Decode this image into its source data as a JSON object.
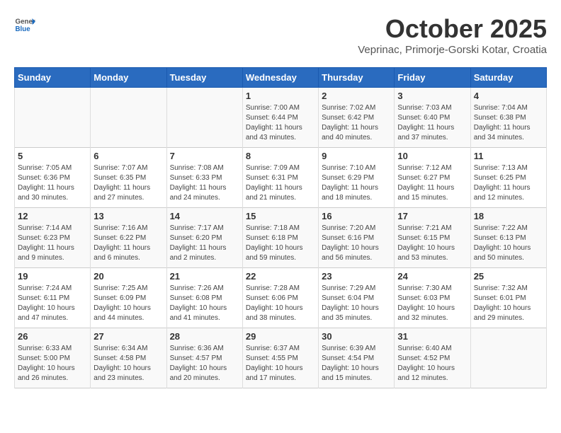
{
  "header": {
    "logo_general": "General",
    "logo_blue": "Blue",
    "month_title": "October 2025",
    "location": "Veprinac, Primorje-Gorski Kotar, Croatia"
  },
  "days_of_week": [
    "Sunday",
    "Monday",
    "Tuesday",
    "Wednesday",
    "Thursday",
    "Friday",
    "Saturday"
  ],
  "weeks": [
    [
      {
        "day": "",
        "content": ""
      },
      {
        "day": "",
        "content": ""
      },
      {
        "day": "",
        "content": ""
      },
      {
        "day": "1",
        "content": "Sunrise: 7:00 AM\nSunset: 6:44 PM\nDaylight: 11 hours\nand 43 minutes."
      },
      {
        "day": "2",
        "content": "Sunrise: 7:02 AM\nSunset: 6:42 PM\nDaylight: 11 hours\nand 40 minutes."
      },
      {
        "day": "3",
        "content": "Sunrise: 7:03 AM\nSunset: 6:40 PM\nDaylight: 11 hours\nand 37 minutes."
      },
      {
        "day": "4",
        "content": "Sunrise: 7:04 AM\nSunset: 6:38 PM\nDaylight: 11 hours\nand 34 minutes."
      }
    ],
    [
      {
        "day": "5",
        "content": "Sunrise: 7:05 AM\nSunset: 6:36 PM\nDaylight: 11 hours\nand 30 minutes."
      },
      {
        "day": "6",
        "content": "Sunrise: 7:07 AM\nSunset: 6:35 PM\nDaylight: 11 hours\nand 27 minutes."
      },
      {
        "day": "7",
        "content": "Sunrise: 7:08 AM\nSunset: 6:33 PM\nDaylight: 11 hours\nand 24 minutes."
      },
      {
        "day": "8",
        "content": "Sunrise: 7:09 AM\nSunset: 6:31 PM\nDaylight: 11 hours\nand 21 minutes."
      },
      {
        "day": "9",
        "content": "Sunrise: 7:10 AM\nSunset: 6:29 PM\nDaylight: 11 hours\nand 18 minutes."
      },
      {
        "day": "10",
        "content": "Sunrise: 7:12 AM\nSunset: 6:27 PM\nDaylight: 11 hours\nand 15 minutes."
      },
      {
        "day": "11",
        "content": "Sunrise: 7:13 AM\nSunset: 6:25 PM\nDaylight: 11 hours\nand 12 minutes."
      }
    ],
    [
      {
        "day": "12",
        "content": "Sunrise: 7:14 AM\nSunset: 6:23 PM\nDaylight: 11 hours\nand 9 minutes."
      },
      {
        "day": "13",
        "content": "Sunrise: 7:16 AM\nSunset: 6:22 PM\nDaylight: 11 hours\nand 6 minutes."
      },
      {
        "day": "14",
        "content": "Sunrise: 7:17 AM\nSunset: 6:20 PM\nDaylight: 11 hours\nand 2 minutes."
      },
      {
        "day": "15",
        "content": "Sunrise: 7:18 AM\nSunset: 6:18 PM\nDaylight: 10 hours\nand 59 minutes."
      },
      {
        "day": "16",
        "content": "Sunrise: 7:20 AM\nSunset: 6:16 PM\nDaylight: 10 hours\nand 56 minutes."
      },
      {
        "day": "17",
        "content": "Sunrise: 7:21 AM\nSunset: 6:15 PM\nDaylight: 10 hours\nand 53 minutes."
      },
      {
        "day": "18",
        "content": "Sunrise: 7:22 AM\nSunset: 6:13 PM\nDaylight: 10 hours\nand 50 minutes."
      }
    ],
    [
      {
        "day": "19",
        "content": "Sunrise: 7:24 AM\nSunset: 6:11 PM\nDaylight: 10 hours\nand 47 minutes."
      },
      {
        "day": "20",
        "content": "Sunrise: 7:25 AM\nSunset: 6:09 PM\nDaylight: 10 hours\nand 44 minutes."
      },
      {
        "day": "21",
        "content": "Sunrise: 7:26 AM\nSunset: 6:08 PM\nDaylight: 10 hours\nand 41 minutes."
      },
      {
        "day": "22",
        "content": "Sunrise: 7:28 AM\nSunset: 6:06 PM\nDaylight: 10 hours\nand 38 minutes."
      },
      {
        "day": "23",
        "content": "Sunrise: 7:29 AM\nSunset: 6:04 PM\nDaylight: 10 hours\nand 35 minutes."
      },
      {
        "day": "24",
        "content": "Sunrise: 7:30 AM\nSunset: 6:03 PM\nDaylight: 10 hours\nand 32 minutes."
      },
      {
        "day": "25",
        "content": "Sunrise: 7:32 AM\nSunset: 6:01 PM\nDaylight: 10 hours\nand 29 minutes."
      }
    ],
    [
      {
        "day": "26",
        "content": "Sunrise: 6:33 AM\nSunset: 5:00 PM\nDaylight: 10 hours\nand 26 minutes."
      },
      {
        "day": "27",
        "content": "Sunrise: 6:34 AM\nSunset: 4:58 PM\nDaylight: 10 hours\nand 23 minutes."
      },
      {
        "day": "28",
        "content": "Sunrise: 6:36 AM\nSunset: 4:57 PM\nDaylight: 10 hours\nand 20 minutes."
      },
      {
        "day": "29",
        "content": "Sunrise: 6:37 AM\nSunset: 4:55 PM\nDaylight: 10 hours\nand 17 minutes."
      },
      {
        "day": "30",
        "content": "Sunrise: 6:39 AM\nSunset: 4:54 PM\nDaylight: 10 hours\nand 15 minutes."
      },
      {
        "day": "31",
        "content": "Sunrise: 6:40 AM\nSunset: 4:52 PM\nDaylight: 10 hours\nand 12 minutes."
      },
      {
        "day": "",
        "content": ""
      }
    ]
  ]
}
